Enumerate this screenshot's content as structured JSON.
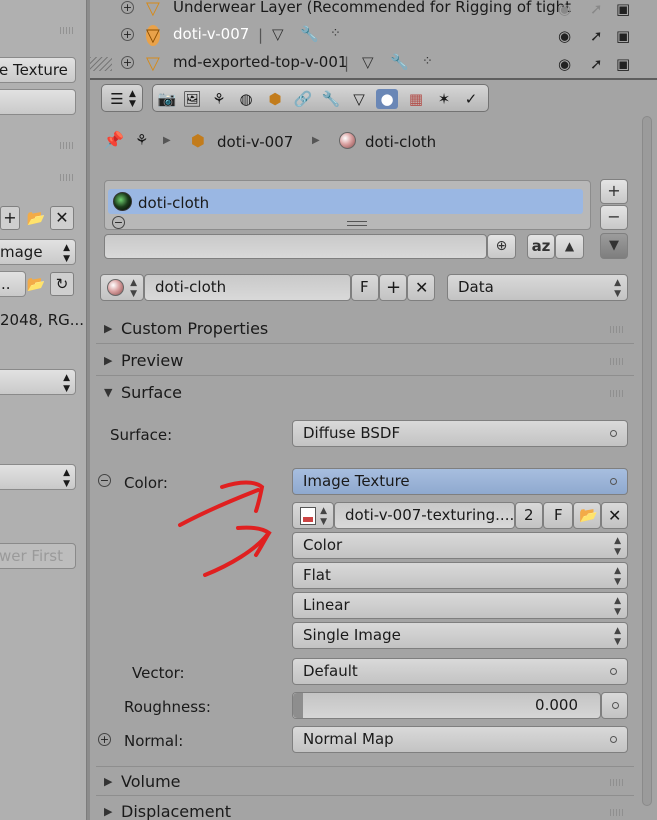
{
  "left_panel": {
    "texture_field": "e Texture",
    "image_select": "mage",
    "resolution_text": "2048, RG...",
    "dots_field": "..",
    "render_btn": "wer First"
  },
  "outliner": {
    "rows": [
      {
        "label": "Underwear Layer (Recommended for Rigging of tight"
      },
      {
        "label": "doti-v-007"
      },
      {
        "label": "md-exported-top-v-001"
      }
    ]
  },
  "breadcrumb": {
    "object": "doti-v-007",
    "material": "doti-cloth"
  },
  "material_slots": {
    "items": [
      {
        "label": "doti-cloth"
      }
    ],
    "filter_placeholder": "",
    "sort_label": "az"
  },
  "material_datablock": {
    "name": "doti-cloth",
    "fake_user": "F",
    "link": "Data"
  },
  "panels": {
    "custom_properties": "Custom Properties",
    "preview": "Preview",
    "surface": "Surface",
    "volume": "Volume",
    "displacement": "Displacement"
  },
  "surface": {
    "surface_label": "Surface:",
    "surface_value": "Diffuse BSDF",
    "color_label": "Color:",
    "color_value": "Image Texture",
    "image_name": "doti-v-007-texturing....",
    "image_users": "2",
    "image_fake": "F",
    "color_space": "Color",
    "projection": "Flat",
    "interpolation": "Linear",
    "source": "Single Image",
    "vector_label": "Vector:",
    "vector_value": "Default",
    "roughness_label": "Roughness:",
    "roughness_value": "0.000",
    "normal_label": "Normal:",
    "normal_value": "Normal Map"
  },
  "colors": {
    "selection": "#9ab7e3",
    "active_tab": "#6a87b6",
    "annotation": "#e02020",
    "object_icon": "#d58a1a"
  }
}
